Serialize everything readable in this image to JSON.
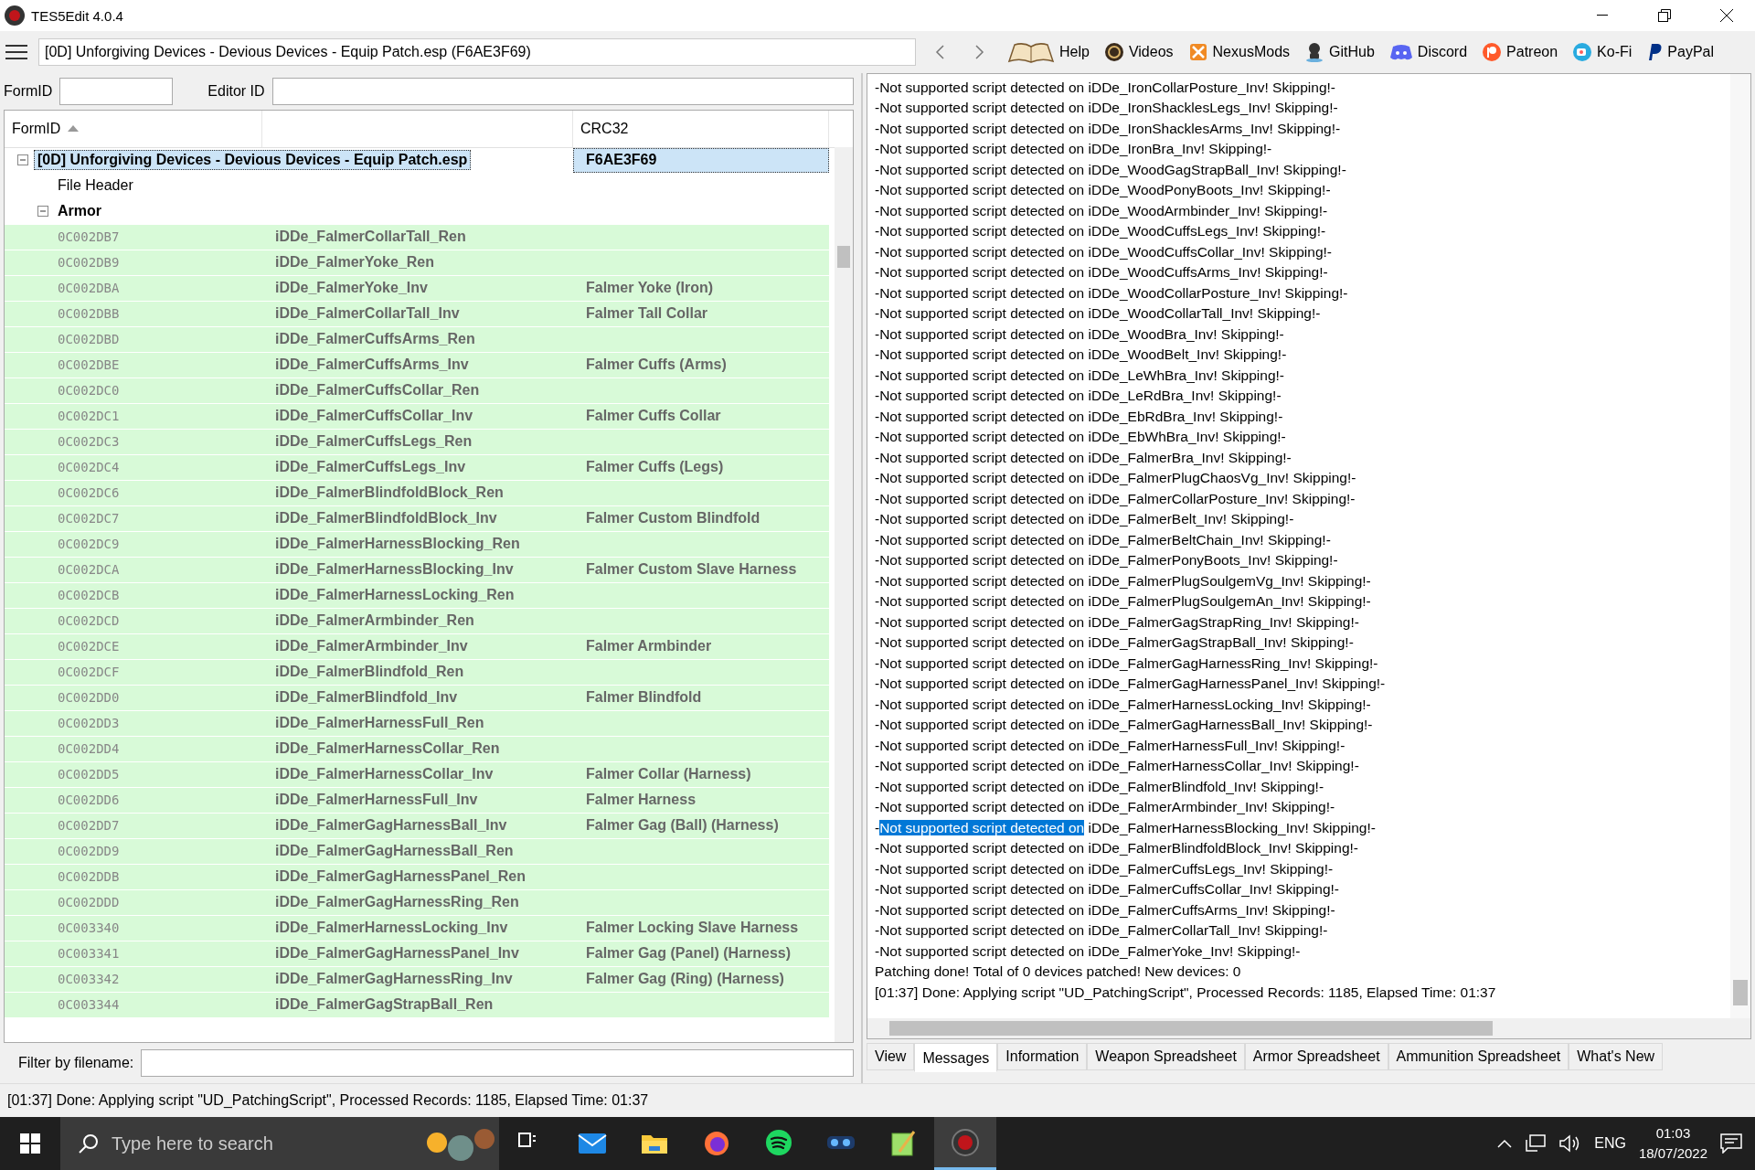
{
  "window": {
    "title": "TES5Edit 4.0.4"
  },
  "toolbar": {
    "path": "[0D] Unforgiving Devices - Devious Devices - Equip Patch.esp (F6AE3F69)",
    "links": [
      {
        "kind": "book",
        "label": "Help"
      },
      {
        "kind": "gp",
        "label": "Videos"
      },
      {
        "kind": "nexus",
        "label": "NexusMods"
      },
      {
        "kind": "github",
        "label": "GitHub"
      },
      {
        "kind": "discord",
        "label": "Discord"
      },
      {
        "kind": "patreon",
        "label": "Patreon"
      },
      {
        "kind": "kofi",
        "label": "Ko-Fi"
      },
      {
        "kind": "paypal",
        "label": "PayPal"
      }
    ]
  },
  "filters": {
    "formid_label": "FormID",
    "editorid_label": "Editor ID",
    "filename_label": "Filter by filename:"
  },
  "tree": {
    "columns": [
      "FormID",
      "CRC32"
    ],
    "nodes": [
      {
        "label": "[0D] Unforgiving Devices - Devious Devices - Equip Patch.esp",
        "crc": "F6AE3F69",
        "selected": true,
        "expanded": true,
        "children": [
          {
            "label": "File Header"
          },
          {
            "label": "Armor",
            "expanded": true,
            "children": [
              {
                "formid": "0C002DB7",
                "editor_id": "iDDe_FalmerCollarTall_Ren"
              },
              {
                "formid": "0C002DB9",
                "editor_id": "iDDe_FalmerYoke_Ren"
              },
              {
                "formid": "0C002DBA",
                "editor_id": "iDDe_FalmerYoke_Inv",
                "name": "Falmer Yoke (Iron)"
              },
              {
                "formid": "0C002DBB",
                "editor_id": "iDDe_FalmerCollarTall_Inv",
                "name": "Falmer Tall Collar"
              },
              {
                "formid": "0C002DBD",
                "editor_id": "iDDe_FalmerCuffsArms_Ren"
              },
              {
                "formid": "0C002DBE",
                "editor_id": "iDDe_FalmerCuffsArms_Inv",
                "name": "Falmer Cuffs (Arms)"
              },
              {
                "formid": "0C002DC0",
                "editor_id": "iDDe_FalmerCuffsCollar_Ren"
              },
              {
                "formid": "0C002DC1",
                "editor_id": "iDDe_FalmerCuffsCollar_Inv",
                "name": "Falmer Cuffs Collar"
              },
              {
                "formid": "0C002DC3",
                "editor_id": "iDDe_FalmerCuffsLegs_Ren"
              },
              {
                "formid": "0C002DC4",
                "editor_id": "iDDe_FalmerCuffsLegs_Inv",
                "name": "Falmer Cuffs (Legs)"
              },
              {
                "formid": "0C002DC6",
                "editor_id": "iDDe_FalmerBlindfoldBlock_Ren"
              },
              {
                "formid": "0C002DC7",
                "editor_id": "iDDe_FalmerBlindfoldBlock_Inv",
                "name": "Falmer Custom Blindfold"
              },
              {
                "formid": "0C002DC9",
                "editor_id": "iDDe_FalmerHarnessBlocking_Ren"
              },
              {
                "formid": "0C002DCA",
                "editor_id": "iDDe_FalmerHarnessBlocking_Inv",
                "name": "Falmer Custom Slave Harness"
              },
              {
                "formid": "0C002DCB",
                "editor_id": "iDDe_FalmerHarnessLocking_Ren"
              },
              {
                "formid": "0C002DCD",
                "editor_id": "iDDe_FalmerArmbinder_Ren"
              },
              {
                "formid": "0C002DCE",
                "editor_id": "iDDe_FalmerArmbinder_Inv",
                "name": "Falmer Armbinder"
              },
              {
                "formid": "0C002DCF",
                "editor_id": "iDDe_FalmerBlindfold_Ren"
              },
              {
                "formid": "0C002DD0",
                "editor_id": "iDDe_FalmerBlindfold_Inv",
                "name": "Falmer Blindfold"
              },
              {
                "formid": "0C002DD3",
                "editor_id": "iDDe_FalmerHarnessFull_Ren"
              },
              {
                "formid": "0C002DD4",
                "editor_id": "iDDe_FalmerHarnessCollar_Ren"
              },
              {
                "formid": "0C002DD5",
                "editor_id": "iDDe_FalmerHarnessCollar_Inv",
                "name": "Falmer Collar (Harness)"
              },
              {
                "formid": "0C002DD6",
                "editor_id": "iDDe_FalmerHarnessFull_Inv",
                "name": "Falmer Harness"
              },
              {
                "formid": "0C002DD7",
                "editor_id": "iDDe_FalmerGagHarnessBall_Inv",
                "name": "Falmer Gag (Ball) (Harness)"
              },
              {
                "formid": "0C002DD9",
                "editor_id": "iDDe_FalmerGagHarnessBall_Ren"
              },
              {
                "formid": "0C002DDB",
                "editor_id": "iDDe_FalmerGagHarnessPanel_Ren"
              },
              {
                "formid": "0C002DDD",
                "editor_id": "iDDe_FalmerGagHarnessRing_Ren"
              },
              {
                "formid": "0C003340",
                "editor_id": "iDDe_FalmerHarnessLocking_Inv",
                "name": "Falmer Locking Slave Harness"
              },
              {
                "formid": "0C003341",
                "editor_id": "iDDe_FalmerGagHarnessPanel_Inv",
                "name": "Falmer Gag (Panel) (Harness)"
              },
              {
                "formid": "0C003342",
                "editor_id": "iDDe_FalmerGagHarnessRing_Inv",
                "name": "Falmer Gag (Ring) (Harness)"
              },
              {
                "formid": "0C003344",
                "editor_id": "iDDe_FalmerGagStrapBall_Ren"
              }
            ]
          }
        ]
      }
    ]
  },
  "messages": [
    {
      "kind": "plain",
      "text": "-Not supported script detected on iDDe_IronCollarPosture_Inv! Skipping!-"
    },
    {
      "kind": "plain",
      "text": "-Not supported script detected on iDDe_IronShacklesLegs_Inv! Skipping!-"
    },
    {
      "kind": "plain",
      "text": "-Not supported script detected on iDDe_IronShacklesArms_Inv! Skipping!-"
    },
    {
      "kind": "plain",
      "text": "-Not supported script detected on iDDe_IronBra_Inv! Skipping!-"
    },
    {
      "kind": "plain",
      "text": "-Not supported script detected on iDDe_WoodGagStrapBall_Inv! Skipping!-"
    },
    {
      "kind": "plain",
      "text": "-Not supported script detected on iDDe_WoodPonyBoots_Inv! Skipping!-"
    },
    {
      "kind": "plain",
      "text": "-Not supported script detected on iDDe_WoodArmbinder_Inv! Skipping!-"
    },
    {
      "kind": "plain",
      "text": "-Not supported script detected on iDDe_WoodCuffsLegs_Inv! Skipping!-"
    },
    {
      "kind": "plain",
      "text": "-Not supported script detected on iDDe_WoodCuffsCollar_Inv! Skipping!-"
    },
    {
      "kind": "plain",
      "text": "-Not supported script detected on iDDe_WoodCuffsArms_Inv! Skipping!-"
    },
    {
      "kind": "plain",
      "text": "-Not supported script detected on iDDe_WoodCollarPosture_Inv! Skipping!-"
    },
    {
      "kind": "plain",
      "text": "-Not supported script detected on iDDe_WoodCollarTall_Inv! Skipping!-"
    },
    {
      "kind": "plain",
      "text": "-Not supported script detected on iDDe_WoodBra_Inv! Skipping!-"
    },
    {
      "kind": "plain",
      "text": "-Not supported script detected on iDDe_WoodBelt_Inv! Skipping!-"
    },
    {
      "kind": "plain",
      "text": "-Not supported script detected on iDDe_LeWhBra_Inv! Skipping!-"
    },
    {
      "kind": "plain",
      "text": "-Not supported script detected on iDDe_LeRdBra_Inv! Skipping!-"
    },
    {
      "kind": "plain",
      "text": "-Not supported script detected on iDDe_EbRdBra_Inv! Skipping!-"
    },
    {
      "kind": "plain",
      "text": "-Not supported script detected on iDDe_EbWhBra_Inv! Skipping!-"
    },
    {
      "kind": "plain",
      "text": "-Not supported script detected on iDDe_FalmerBra_Inv! Skipping!-"
    },
    {
      "kind": "plain",
      "text": "-Not supported script detected on iDDe_FalmerPlugChaosVg_Inv! Skipping!-"
    },
    {
      "kind": "plain",
      "text": "-Not supported script detected on iDDe_FalmerCollarPosture_Inv! Skipping!-"
    },
    {
      "kind": "plain",
      "text": "-Not supported script detected on iDDe_FalmerBelt_Inv! Skipping!-"
    },
    {
      "kind": "plain",
      "text": "-Not supported script detected on iDDe_FalmerBeltChain_Inv! Skipping!-"
    },
    {
      "kind": "plain",
      "text": "-Not supported script detected on iDDe_FalmerPonyBoots_Inv! Skipping!-"
    },
    {
      "kind": "plain",
      "text": "-Not supported script detected on iDDe_FalmerPlugSoulgemVg_Inv! Skipping!-"
    },
    {
      "kind": "plain",
      "text": "-Not supported script detected on iDDe_FalmerPlugSoulgemAn_Inv! Skipping!-"
    },
    {
      "kind": "plain",
      "text": "-Not supported script detected on iDDe_FalmerGagStrapRing_Inv! Skipping!-"
    },
    {
      "kind": "plain",
      "text": "-Not supported script detected on iDDe_FalmerGagStrapBall_Inv! Skipping!-"
    },
    {
      "kind": "plain",
      "text": "-Not supported script detected on iDDe_FalmerGagHarnessRing_Inv! Skipping!-"
    },
    {
      "kind": "plain",
      "text": "-Not supported script detected on iDDe_FalmerGagHarnessPanel_Inv! Skipping!-"
    },
    {
      "kind": "plain",
      "text": "-Not supported script detected on iDDe_FalmerHarnessLocking_Inv! Skipping!-"
    },
    {
      "kind": "plain",
      "text": "-Not supported script detected on iDDe_FalmerGagHarnessBall_Inv! Skipping!-"
    },
    {
      "kind": "plain",
      "text": "-Not supported script detected on iDDe_FalmerHarnessFull_Inv! Skipping!-"
    },
    {
      "kind": "plain",
      "text": "-Not supported script detected on iDDe_FalmerHarnessCollar_Inv! Skipping!-"
    },
    {
      "kind": "plain",
      "text": "-Not supported script detected on iDDe_FalmerBlindfold_Inv! Skipping!-"
    },
    {
      "kind": "plain",
      "text": "-Not supported script detected on iDDe_FalmerArmbinder_Inv! Skipping!-"
    },
    {
      "kind": "highlight",
      "before": "-",
      "highlighted": "Not supported script detected on",
      "after": " iDDe_FalmerHarnessBlocking_Inv! Skipping!-"
    },
    {
      "kind": "plain",
      "text": "-Not supported script detected on iDDe_FalmerBlindfoldBlock_Inv! Skipping!-"
    },
    {
      "kind": "plain",
      "text": "-Not supported script detected on iDDe_FalmerCuffsLegs_Inv! Skipping!-"
    },
    {
      "kind": "plain",
      "text": "-Not supported script detected on iDDe_FalmerCuffsCollar_Inv! Skipping!-"
    },
    {
      "kind": "plain",
      "text": "-Not supported script detected on iDDe_FalmerCuffsArms_Inv! Skipping!-"
    },
    {
      "kind": "plain",
      "text": "-Not supported script detected on iDDe_FalmerCollarTall_Inv! Skipping!-"
    },
    {
      "kind": "plain",
      "text": "-Not supported script detected on iDDe_FalmerYoke_Inv! Skipping!-"
    },
    {
      "kind": "plain",
      "text": "Patching done! Total of 0 devices patched! New devices: 0"
    },
    {
      "kind": "plain",
      "text": "[01:37] Done: Applying script \"UD_PatchingScript\", Processed Records: 1185, Elapsed Time: 01:37"
    }
  ],
  "tabs": [
    {
      "label": "View",
      "selected": false
    },
    {
      "label": "Messages",
      "selected": true
    },
    {
      "label": "Information",
      "selected": false
    },
    {
      "label": "Weapon Spreadsheet",
      "selected": false
    },
    {
      "label": "Armor Spreadsheet",
      "selected": false
    },
    {
      "label": "Ammunition Spreadsheet",
      "selected": false
    },
    {
      "label": "What's New",
      "selected": false
    }
  ],
  "status_bar": "[01:37] Done: Applying script \"UD_PatchingScript\", Processed Records: 1185, Elapsed Time: 01:37",
  "taskbar": {
    "search_placeholder": "Type here to search",
    "apps": [
      {
        "kind": "taskview",
        "selected": false
      },
      {
        "kind": "mail",
        "selected": false
      },
      {
        "kind": "explorer",
        "selected": false
      },
      {
        "kind": "firefox",
        "selected": false
      },
      {
        "kind": "spotify",
        "selected": false
      },
      {
        "kind": "organizer",
        "selected": false
      },
      {
        "kind": "notepad",
        "selected": false
      },
      {
        "kind": "xedit",
        "selected": true
      }
    ],
    "language": "ENG",
    "time": "01:03",
    "date": "18/07/2022"
  }
}
